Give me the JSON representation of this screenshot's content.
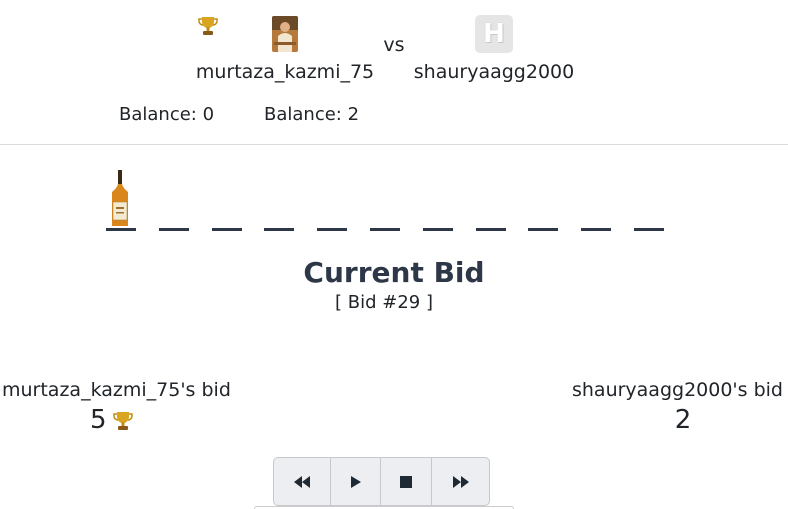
{
  "players": {
    "p1": {
      "name": "murtaza_kazmi_75",
      "balance": "Balance: 0",
      "bid_label": "murtaza_kazmi_75's bid",
      "bid_value": "5"
    },
    "p2": {
      "name": "shauryaagg2000",
      "balance": "Balance: 2",
      "bid_label": "shauryaagg2000's bid",
      "bid_value": "2",
      "avatar_letter": "H"
    }
  },
  "vs": "vs",
  "current_bid": {
    "title": "Current Bid",
    "bid_number": "[ Bid #29 ]"
  },
  "word": {
    "item_icon": "whisky-bottle-icon",
    "slots_count": 11
  },
  "icons": {
    "winner": "trophy-icon"
  },
  "controls": [
    "rewind-button",
    "play-button",
    "stop-button",
    "fast-forward-button"
  ],
  "colors": {
    "accent": "#2d3748",
    "trophy": "#d4a017",
    "control_bg": "#eceef1"
  }
}
